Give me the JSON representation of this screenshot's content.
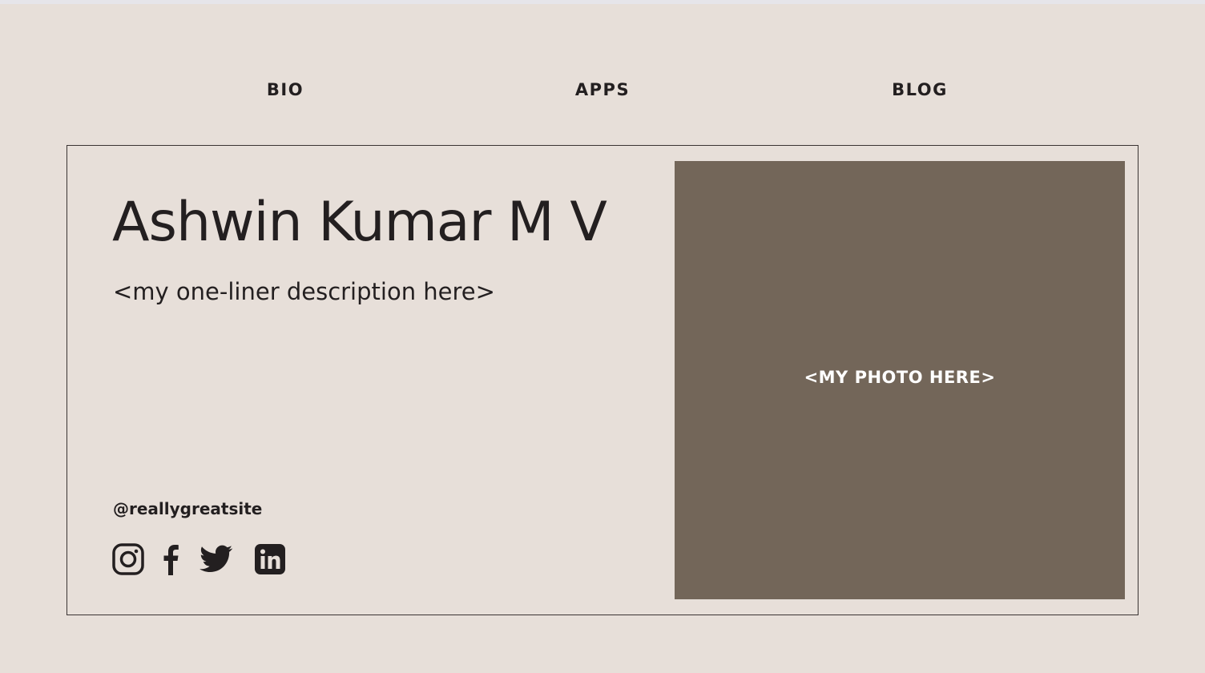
{
  "nav": {
    "items": [
      {
        "label": "BIO"
      },
      {
        "label": "APPS"
      },
      {
        "label": "BLOG"
      }
    ]
  },
  "profile": {
    "name": "Ashwin Kumar M V",
    "tagline": "<my one-liner description here>",
    "handle": "@reallygreatsite"
  },
  "socials": [
    {
      "icon": "instagram-icon"
    },
    {
      "icon": "facebook-icon"
    },
    {
      "icon": "twitter-icon"
    },
    {
      "icon": "linkedin-icon"
    }
  ],
  "photo": {
    "placeholder": "<MY PHOTO HERE>"
  },
  "colors": {
    "background": "#e7dfd9",
    "text": "#231f20",
    "photo_fill": "#736659",
    "photo_text": "#ffffff"
  }
}
